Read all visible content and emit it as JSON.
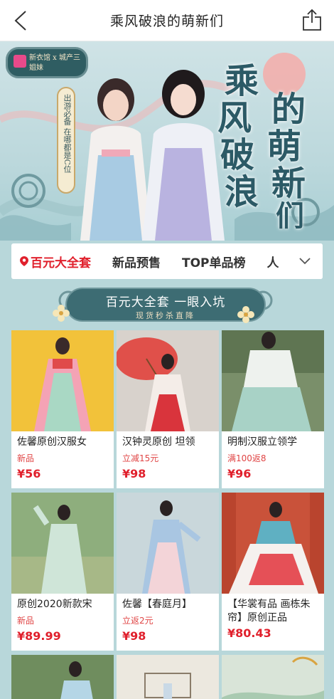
{
  "nav": {
    "title": "乘风破浪的萌新们"
  },
  "hero": {
    "brand": "新衣馆 x 城产三姐妹",
    "tagline": "出游必备 在哪都是C位",
    "calligraphy": [
      "乘",
      "风",
      "破",
      "浪",
      "的",
      "萌",
      "新",
      "们"
    ]
  },
  "tabs": [
    {
      "label": "百元大全套",
      "active": true
    },
    {
      "label": "新品预售",
      "active": false
    },
    {
      "label": "TOP单品榜",
      "active": false
    },
    {
      "label": "人",
      "active": false
    }
  ],
  "section": {
    "title": "百元大全套 一眼入坑",
    "subtitle": "现货秒杀直降"
  },
  "products": [
    {
      "title": "佐馨原创汉服女",
      "tag": "新品",
      "price": "¥56"
    },
    {
      "title": "汉钟灵原创 坦领",
      "tag": "立减15元",
      "price": "¥98"
    },
    {
      "title": "明制汉服立领学",
      "tag": "满100返8",
      "price": "¥96"
    },
    {
      "title": "原创2020新款宋",
      "tag": "新品",
      "price": "¥89.99"
    },
    {
      "title": "佐馨【春庭月】",
      "tag": "立返2元",
      "price": "¥98"
    },
    {
      "title": "【华裳有品 画栋朱帘】原创正品",
      "tag": "",
      "price": "¥80.43"
    }
  ],
  "colors": {
    "accent": "#e0202c",
    "teal": "#3d6c73",
    "page_bg": "#b8d7da"
  }
}
